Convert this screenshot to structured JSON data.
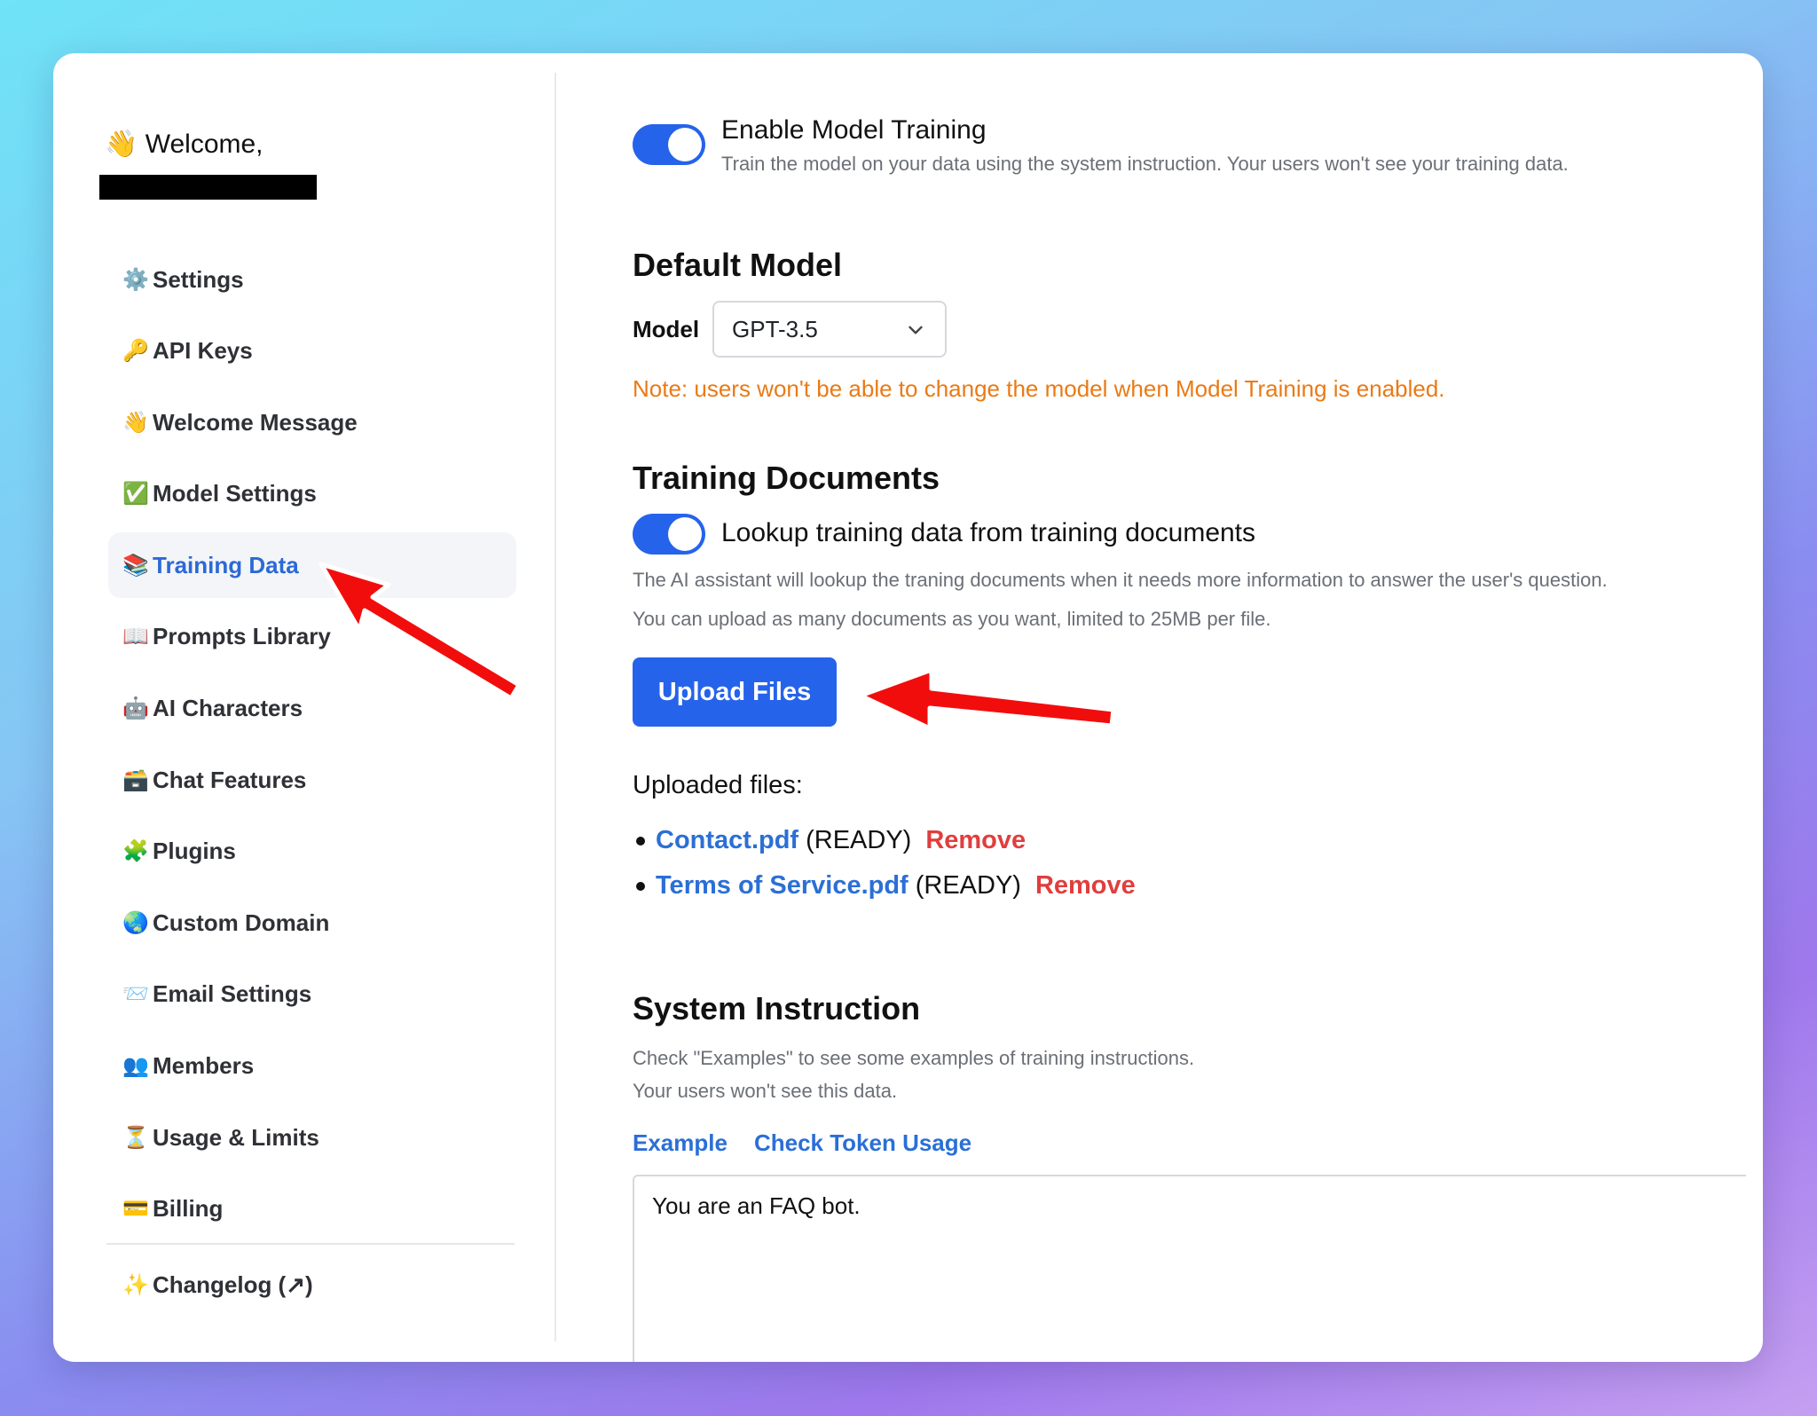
{
  "sidebar": {
    "welcome": {
      "emoji": "👋",
      "text": "Welcome,"
    },
    "items": [
      {
        "emoji": "⚙️",
        "label": "Settings",
        "active": false
      },
      {
        "emoji": "🔑",
        "label": "API Keys",
        "active": false
      },
      {
        "emoji": "👋",
        "label": "Welcome Message",
        "active": false
      },
      {
        "emoji": "✅",
        "label": "Model Settings",
        "active": false
      },
      {
        "emoji": "📚",
        "label": "Training Data",
        "active": true
      },
      {
        "emoji": "📖",
        "label": "Prompts Library",
        "active": false
      },
      {
        "emoji": "🤖",
        "label": "AI Characters",
        "active": false
      },
      {
        "emoji": "🗃️",
        "label": "Chat Features",
        "active": false
      },
      {
        "emoji": "🧩",
        "label": "Plugins",
        "active": false
      },
      {
        "emoji": "🌏",
        "label": "Custom Domain",
        "active": false
      },
      {
        "emoji": "📨",
        "label": "Email Settings",
        "active": false
      },
      {
        "emoji": "👥",
        "label": "Members",
        "active": false
      },
      {
        "emoji": "⏳",
        "label": "Usage & Limits",
        "active": false
      },
      {
        "emoji": "💳",
        "label": "Billing",
        "active": false
      }
    ],
    "changelog": {
      "emoji": "✨",
      "label": "Changelog (↗)"
    }
  },
  "training": {
    "toggle_on": true,
    "title": "Enable Model Training",
    "description": "Train the model on your data using the system instruction. Your users won't see your training data."
  },
  "default_model": {
    "heading": "Default Model",
    "label": "Model",
    "selected": "GPT-3.5",
    "note": "Note: users won't be able to change the model when Model Training is enabled."
  },
  "documents": {
    "heading": "Training Documents",
    "toggle_on": true,
    "toggle_label": "Lookup training data from training documents",
    "desc1": "The AI assistant will lookup the traning documents when it needs more information to answer the user's question.",
    "desc2": "You can upload as many documents as you want, limited to 25MB per file.",
    "upload_label": "Upload Files",
    "uploaded_label": "Uploaded files:",
    "files": [
      {
        "name": "Contact.pdf",
        "status": "(READY)",
        "action": "Remove"
      },
      {
        "name": "Terms of Service.pdf",
        "status": "(READY)",
        "action": "Remove"
      }
    ]
  },
  "system_instruction": {
    "heading": "System Instruction",
    "desc1": "Check \"Examples\" to see some examples of training instructions.",
    "desc2": "Your users won't see this data.",
    "link_example": "Example",
    "link_token": "Check Token Usage",
    "value": "You are an FAQ bot."
  },
  "colors": {
    "accent": "#2563eb",
    "link": "#2b6fd6",
    "warning": "#ea7a16",
    "danger": "#e03e3e",
    "annotation_arrow": "#f20d0d"
  }
}
